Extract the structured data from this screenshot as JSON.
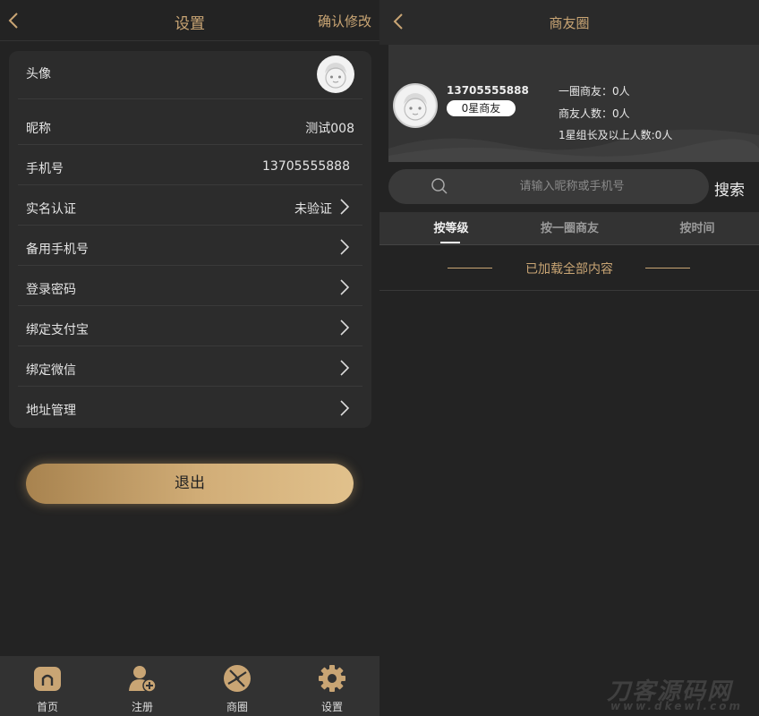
{
  "settings": {
    "title": "设置",
    "confirm_label": "确认修改",
    "rows": [
      {
        "label": "头像"
      },
      {
        "label": "昵称",
        "value": "测试008"
      },
      {
        "label": "手机号",
        "value": "13705555888"
      },
      {
        "label": "实名认证",
        "value": "未验证"
      },
      {
        "label": "备用手机号"
      },
      {
        "label": "登录密码"
      },
      {
        "label": "绑定支付宝"
      },
      {
        "label": "绑定微信"
      },
      {
        "label": "地址管理"
      }
    ],
    "logout_label": "退出"
  },
  "tabbar": {
    "items": [
      {
        "label": "首页",
        "icon": "home-icon"
      },
      {
        "label": "注册",
        "icon": "add-user-icon"
      },
      {
        "label": "商圈",
        "icon": "aperture-icon"
      },
      {
        "label": "设置",
        "icon": "gear-icon"
      }
    ]
  },
  "circle": {
    "title": "商友圈",
    "profile": {
      "phone": "13705555888",
      "badge": "0星商友",
      "stats": [
        "一圈商友：0人",
        "商友人数：0人",
        "1星组长及以上人数:0人"
      ]
    },
    "search": {
      "placeholder": "请输入昵称或手机号",
      "button": "搜索"
    },
    "sort_tabs": [
      "按等级",
      "按一圈商友",
      "按时间"
    ],
    "loaded_text": "已加载全部内容"
  },
  "watermark": {
    "main": "刀客源码网",
    "sub": "www.dkewl.com"
  },
  "colors": {
    "accent": "#c9a574",
    "background": "#232323",
    "card": "#2c2c2c"
  }
}
